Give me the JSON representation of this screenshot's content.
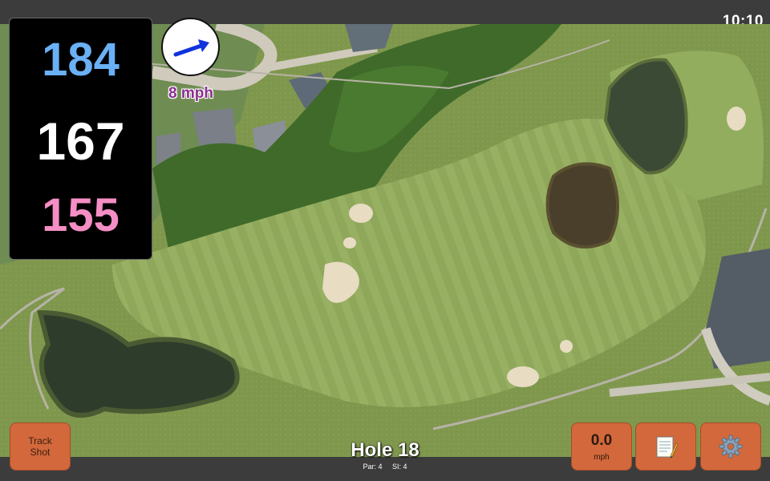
{
  "status": {
    "time": "10:10"
  },
  "yardages": {
    "back": "184",
    "middle": "167",
    "front": "155"
  },
  "wind": {
    "speed": "8 mph",
    "direction_icon": "arrow-icon"
  },
  "hole": {
    "title": "Hole 18",
    "par": "Par: 4",
    "stroke_index": "SI: 4"
  },
  "buttons": {
    "track_shot": {
      "line1": "Track",
      "line2": "Shot"
    },
    "speed": {
      "value": "0.0",
      "unit": "mph"
    },
    "notes": {
      "icon": "notepad-icon"
    },
    "settings": {
      "icon": "gear-icon"
    }
  },
  "colors": {
    "back": "#6ab0f5",
    "middle": "#ffffff",
    "front": "#f58ec4",
    "button": "#d2683b",
    "wind_text": "#8b2e8f"
  }
}
